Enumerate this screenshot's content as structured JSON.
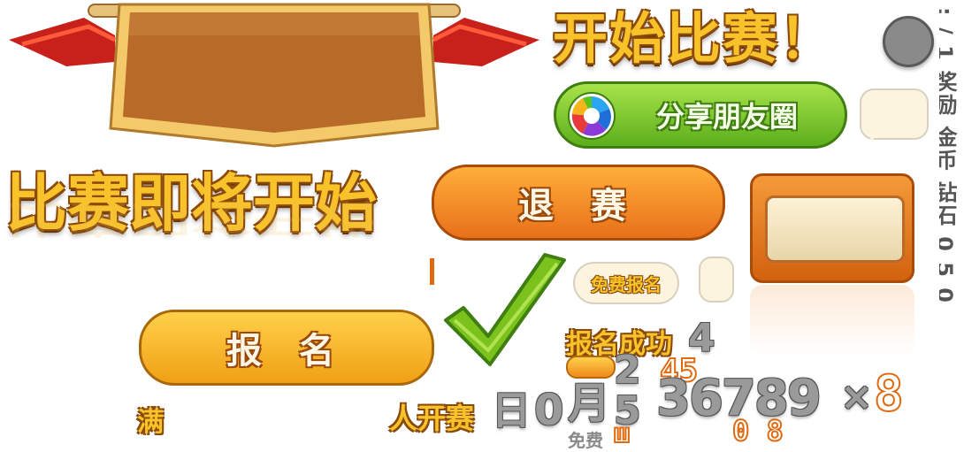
{
  "title_big": "开始比赛！",
  "title_main": "比赛即将开始",
  "title_reflection": "比赛即将开始",
  "share_label": "分享朋友圈",
  "quit_label": "退 赛",
  "signup_label": "报 名",
  "free_signup_label": "免费报名",
  "signup_success": "报名成功",
  "full_label": "满",
  "people_start_label": "人开赛",
  "day_label": "日",
  "zero_label": "0",
  "month_label": "月",
  "free_label": "免费",
  "digits_stack": "2 5",
  "digits_row": "36789",
  "times_label": "×",
  "four_label": "4",
  "orange_digits_top": "45",
  "orange_digits_bottom": "0 8",
  "orange_digits_small": "ш",
  "orange_eight": "8",
  "vertical_text": ": / 1 奖励 金币 钻石 0 5 0",
  "colors": {
    "gold": "#f8c22a",
    "orange_button": "#f08a1c",
    "green_button": "#6cc22c",
    "yellow_button": "#f6b81e",
    "ribbon_red": "#d8291a",
    "panel_brown": "#b86a28"
  }
}
